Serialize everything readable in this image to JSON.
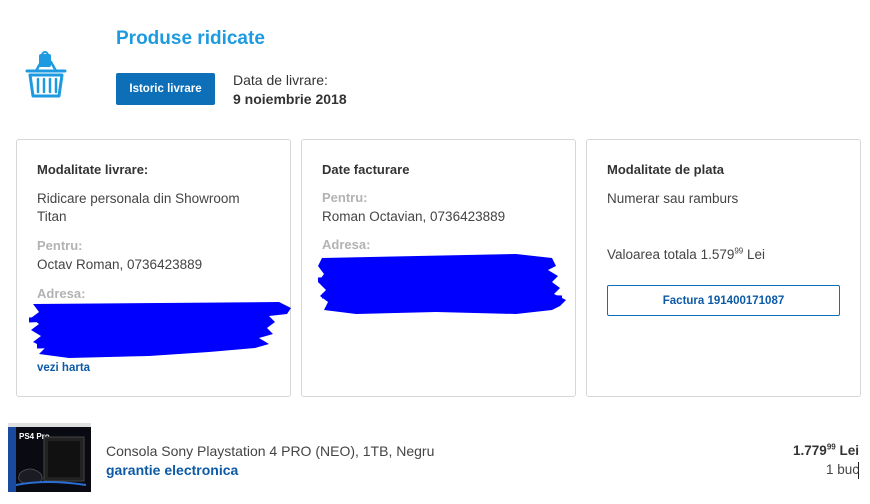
{
  "order": {
    "status_title": "Produse ridicate",
    "history_button": "Istoric livrare",
    "delivery_label": "Data de livrare:",
    "delivery_date": "9 noiembrie 2018"
  },
  "cards": {
    "delivery": {
      "title": "Modalitate livrare:",
      "method_line1": "Ridicare personala din Showroom",
      "method_line2": "Titan",
      "for_label": "Pentru:",
      "for_value": "Octav Roman, 0736423889",
      "address_label": "Adresa:",
      "map_link": "vezi harta"
    },
    "billing": {
      "title": "Date facturare",
      "for_label": "Pentru:",
      "for_value": "Roman Octavian, 0736423889",
      "address_label": "Adresa:"
    },
    "payment": {
      "title": "Modalitate de plata",
      "method": "Numerar sau ramburs",
      "total_label": "Valoarea totala 1.579",
      "total_decimals": "99",
      "total_currency": " Lei",
      "invoice_button": "Factura 191400171087"
    }
  },
  "product": {
    "name": "Consola Sony Playstation 4 PRO (NEO), 1TB, Negru",
    "warranty_link": "garantie electronica",
    "price_main": "1.779",
    "price_decimals": "99",
    "price_currency": " Lei",
    "quantity": "1 buc",
    "box_brand": "PS4 Pro"
  },
  "colors": {
    "accent": "#1e9be0",
    "button": "#0c6fb8",
    "link": "#0c5aa6",
    "redaction": "#0000ff"
  },
  "icons": {
    "basket": "basket-icon"
  }
}
